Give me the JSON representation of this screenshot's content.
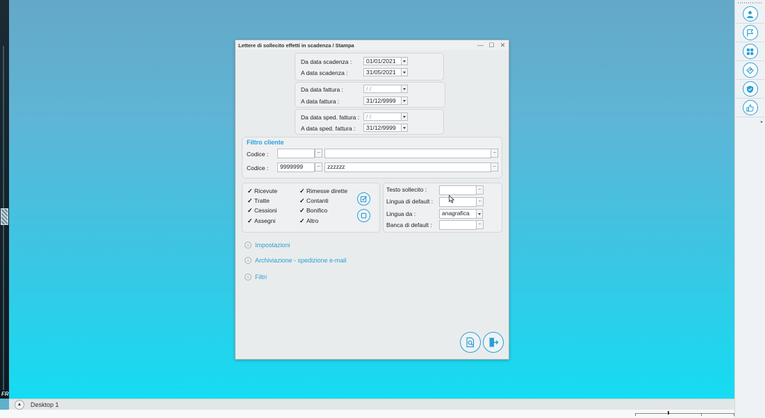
{
  "dialog": {
    "title": "Lettere di sollecito effetti in scadenza / Stampa",
    "date_groups": [
      {
        "from_label": "Da data scadenza :",
        "from_value": "01/01/2021",
        "to_label": "A data scadenza :",
        "to_value": "31/05/2021"
      },
      {
        "from_label": "Da data fattura :",
        "from_value": " / /",
        "to_label": "A data fattura :",
        "to_value": "31/12/9999"
      },
      {
        "from_label": "Da data sped. fattura :",
        "from_value": " / /",
        "to_label": "A data sped. fattura :",
        "to_value": "31/12/9999"
      }
    ],
    "filtro_cliente": {
      "title": "Filtro cliente",
      "rows": [
        {
          "label": "Codice :",
          "code": "",
          "name": ""
        },
        {
          "label": "Codice :",
          "code": "9999999",
          "name": "zzzzzz"
        }
      ]
    },
    "checkboxes": [
      {
        "label": "Ricevute",
        "checked": true
      },
      {
        "label": "Tratte",
        "checked": true
      },
      {
        "label": "Cessioni",
        "checked": true
      },
      {
        "label": "Assegni",
        "checked": true
      },
      {
        "label": "Rimesse dirette",
        "checked": true
      },
      {
        "label": "Contanti",
        "checked": true
      },
      {
        "label": "Bonifico",
        "checked": true
      },
      {
        "label": "Altro",
        "checked": true
      }
    ],
    "right_fields": {
      "testo_label": "Testo sollecito :",
      "testo_value": "",
      "lingua_default_label": "Lingua di default :",
      "lingua_default_value": "",
      "lingua_da_label": "Lingua da :",
      "lingua_da_value": "anagrafica",
      "banca_label": "Banca di default :",
      "banca_value": ""
    },
    "expanders": [
      "Impostazioni",
      "Archiviazione - spedizione e-mail",
      "Filtri"
    ],
    "checkmark_glyph": "✓",
    "ellipsis_glyph": "...",
    "window_controls": {
      "minimize": "—",
      "maximize": "☐",
      "close": "✕"
    }
  },
  "taskbar": {
    "desktop_label": "Desktop 1",
    "left_tag": "FR"
  },
  "right_toolbar": {
    "icons": [
      "user-icon",
      "flag-icon",
      "grid-icon",
      "share-icon",
      "shield-icon",
      "thumbs-up-icon"
    ]
  },
  "colors": {
    "accent": "#2c9ed6",
    "link": "#2a9fd8"
  }
}
